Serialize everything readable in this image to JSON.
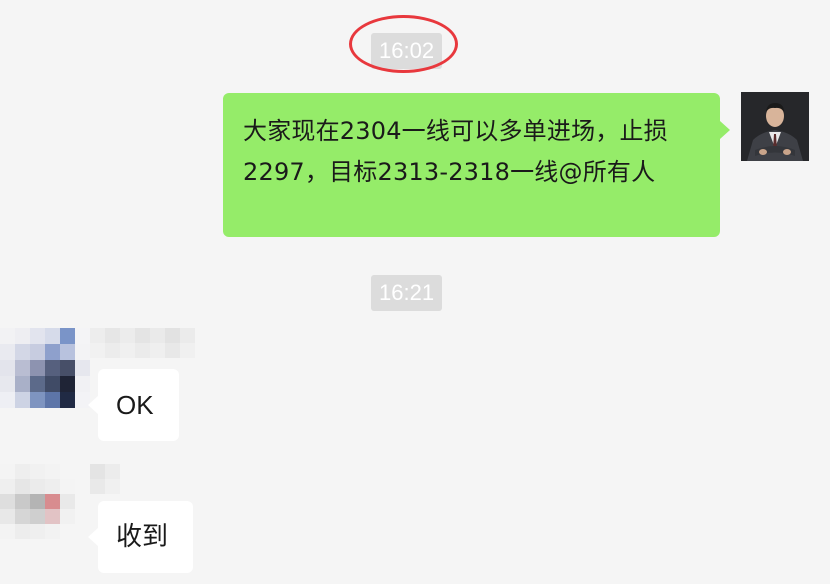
{
  "messages": {
    "timestamp_1": "16:02",
    "outgoing_text": "大家现在2304一线可以多单进场，止损2297，目标2313-2318一线@所有人",
    "timestamp_2": "16:21",
    "incoming_1_text": "OK",
    "incoming_2_text": "收到"
  },
  "colors": {
    "background": "#f5f5f5",
    "outgoing_bubble": "#95ec69",
    "incoming_bubble": "#ffffff",
    "timestamp_bg": "#dcdcdc",
    "annotation_circle": "#e8383d"
  }
}
